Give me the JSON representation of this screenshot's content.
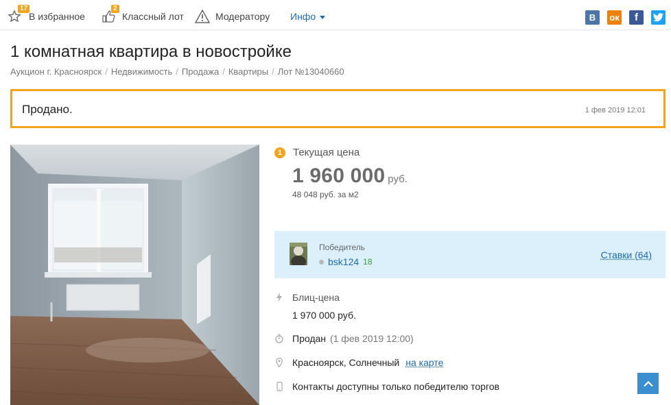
{
  "toolbar": {
    "favorites_label": "В избранное",
    "favorites_count": "17",
    "like_label": "Классный лот",
    "like_count": "2",
    "moderator_label": "Модератору",
    "info_label": "Инфо"
  },
  "social": {
    "vk": "B",
    "ok": "ок",
    "fb": "f",
    "tw": "t"
  },
  "page_title": "1 комнатная квартира в новостройке",
  "breadcrumb": [
    "Аукцион г. Красноярск",
    "Недвижимость",
    "Продажа",
    "Квартиры",
    "Лот №13040660"
  ],
  "status_box": {
    "text": "Продано.",
    "date": "1 фев 2019 12:01"
  },
  "price": {
    "badge": "1",
    "label": "Текущая цена",
    "value": "1 960 000",
    "currency": "руб.",
    "per_m2": "48 048 руб. за м2"
  },
  "winner": {
    "label": "Победитель",
    "username": "bsk124",
    "rating": "18",
    "bids_link": "Ставки (64)"
  },
  "blitz": {
    "label": "Блиц-цена",
    "value": "1 970 000 руб."
  },
  "sold": {
    "label": "Продан",
    "date": "(1 фев 2019 12:00)"
  },
  "location": {
    "text": "Красноярск, Солнечный",
    "map_link": "на карте"
  },
  "contacts": {
    "text": "Контакты доступны только победителю торгов"
  },
  "colors": {
    "accent": "#f5a31a",
    "link": "#1a6bb8",
    "winner_bg": "#dcf0fb"
  }
}
